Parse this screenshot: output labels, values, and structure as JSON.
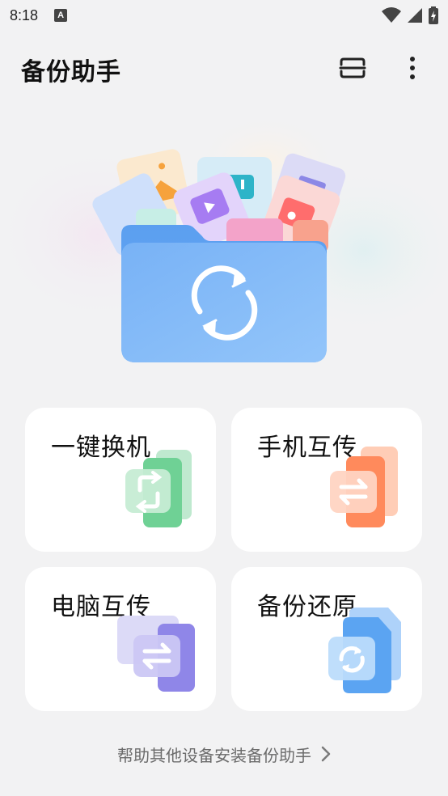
{
  "status_bar": {
    "time": "8:18",
    "notification_icon_text": "A",
    "icons": [
      "wifi-icon",
      "signal-icon",
      "battery-charging-icon"
    ]
  },
  "app_bar": {
    "title": "备份助手",
    "actions": [
      "scan-icon",
      "more-vert-icon"
    ]
  },
  "hero": {
    "center_icon": "sync-icon",
    "colors": {
      "folder": "#6aaaf5",
      "folder_light": "#8ec0f9"
    }
  },
  "cards": [
    {
      "label": "一键换机",
      "icon": "phone-switch-icon",
      "color": "#5dc98a"
    },
    {
      "label": "手机互传",
      "icon": "phone-transfer-icon",
      "color": "#ff8a5c"
    },
    {
      "label": "电脑互传",
      "icon": "pc-transfer-icon",
      "color": "#8f86e8"
    },
    {
      "label": "备份还原",
      "icon": "backup-restore-icon",
      "color": "#5ba4f2"
    }
  ],
  "footer": {
    "link_text": "帮助其他设备安装备份助手",
    "icon": "chevron-right-icon"
  }
}
